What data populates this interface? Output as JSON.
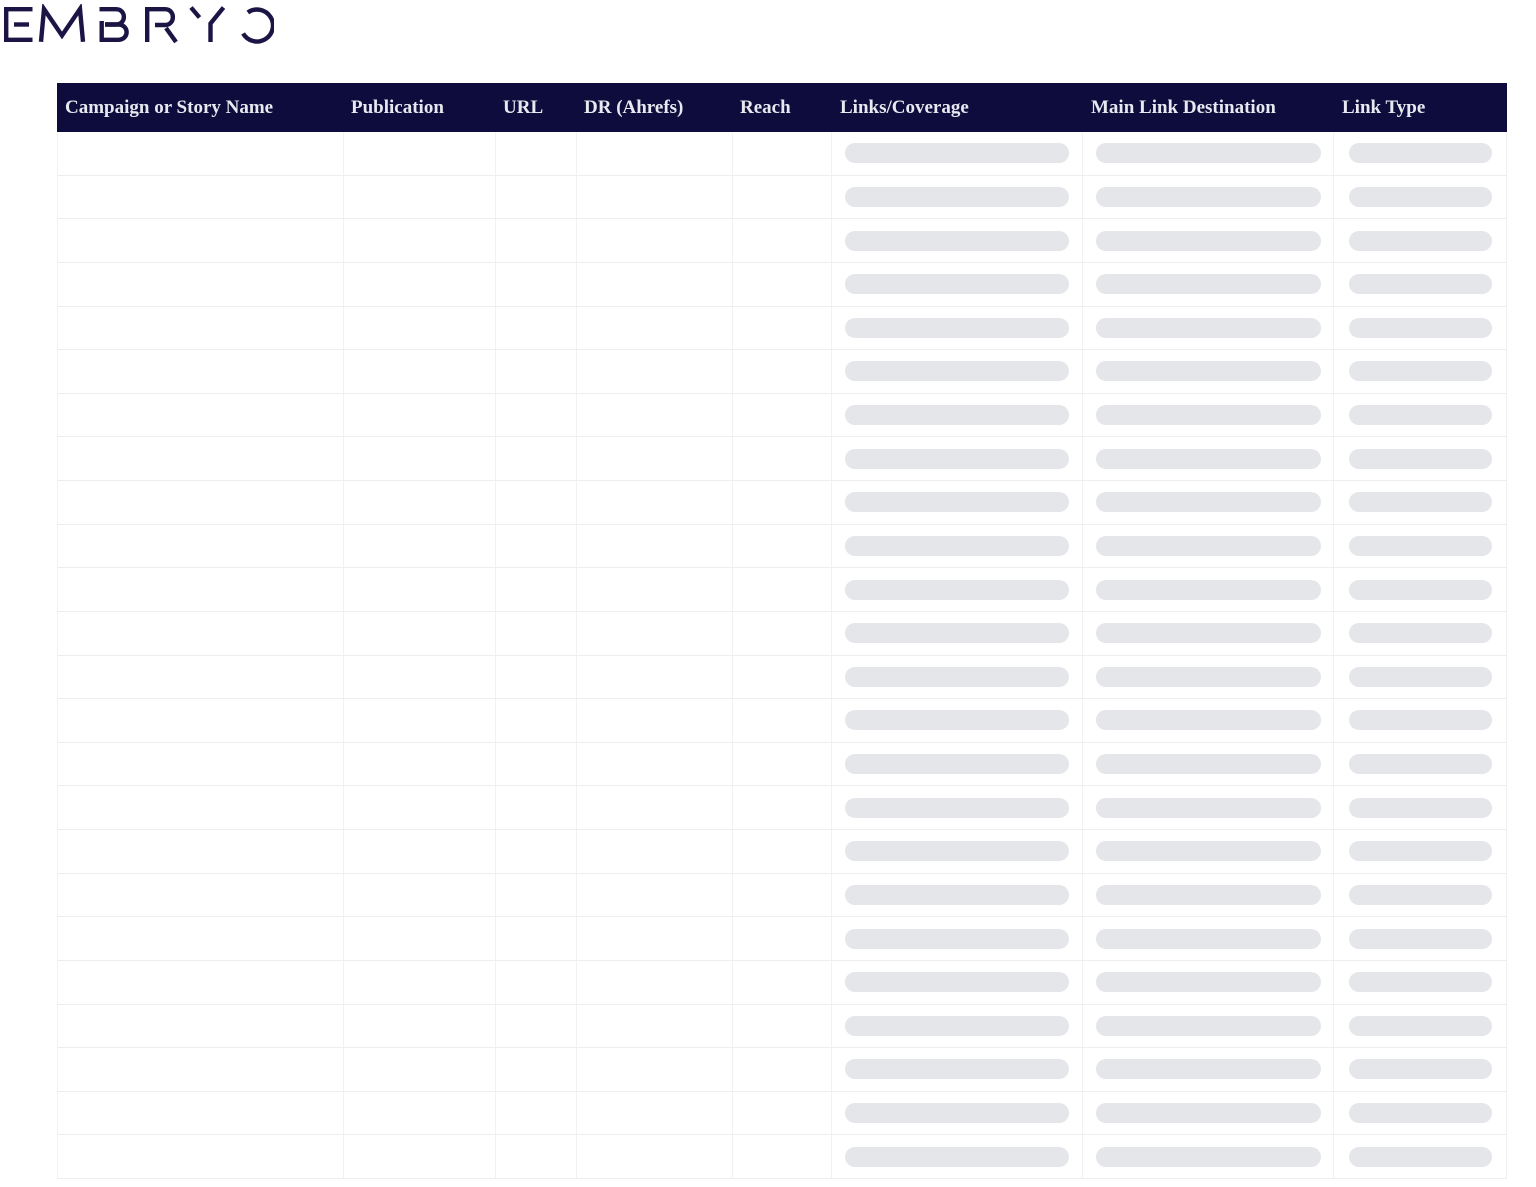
{
  "logo": {
    "brand": "EMBRYO",
    "color": "#1b1545"
  },
  "table": {
    "header": {
      "bg_color": "#0e0c3c",
      "text_color": "#e8e9f0",
      "columns": [
        "Campaign or Story Name",
        "Publication",
        "URL",
        "DR (Ahrefs)",
        "Reach",
        "Links/Coverage",
        "Main Link Destination",
        "Link Type"
      ]
    },
    "body": {
      "row_count": 24,
      "pill_column_indexes": [
        5,
        6,
        7
      ],
      "placeholder_pill_color": "#e4e6ea",
      "grid_line_color": "#eeeeee",
      "cell_values": []
    }
  }
}
